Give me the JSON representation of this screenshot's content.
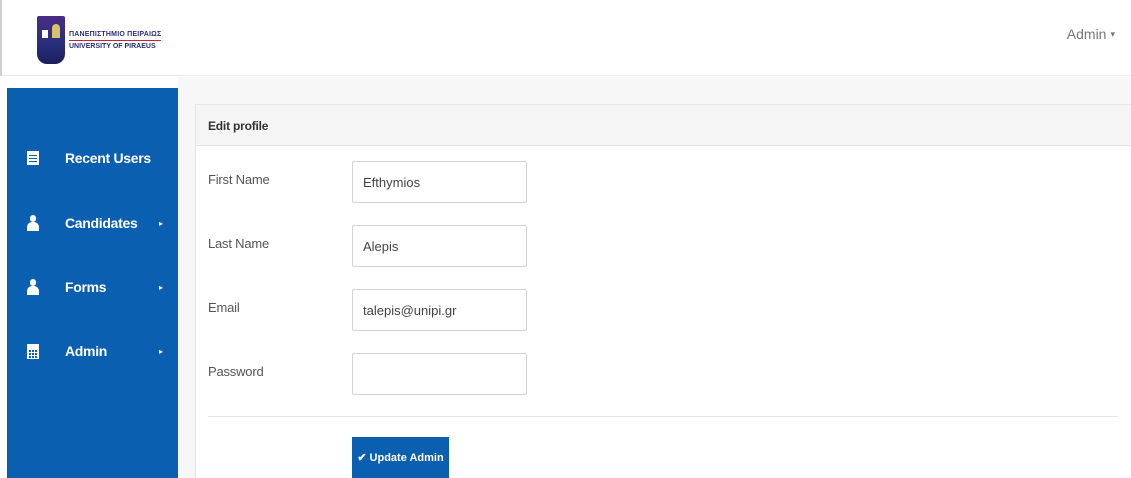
{
  "header": {
    "logo": {
      "greek": "ΠΑΝΕΠΙΣΤΗΜΙΟ ΠΕΙΡΑΙΩΣ",
      "english": "UNIVERSITY OF PIRAEUS"
    },
    "user_menu_label": "Admin",
    "user_menu_caret": "▾"
  },
  "sidebar": {
    "items": [
      {
        "label": "Recent Users",
        "icon": "list-icon",
        "has_submenu": false
      },
      {
        "label": "Candidates",
        "icon": "user-icon",
        "has_submenu": true
      },
      {
        "label": "Forms",
        "icon": "user-icon",
        "has_submenu": true
      },
      {
        "label": "Admin",
        "icon": "calendar-icon",
        "has_submenu": true
      }
    ],
    "submenu_arrow": "▸"
  },
  "panel": {
    "title": "Edit profile",
    "fields": [
      {
        "label": "First Name",
        "value": "Efthymios",
        "placeholder": ""
      },
      {
        "label": "Last Name",
        "value": "Alepis",
        "placeholder": ""
      },
      {
        "label": "Email",
        "value": "talepis@unipi.gr",
        "placeholder": ""
      },
      {
        "label": "Password",
        "value": "",
        "placeholder": ""
      }
    ],
    "submit": {
      "icon": "✔",
      "label": "Update Admin"
    }
  },
  "colors": {
    "sidebar": "#0b5fb0",
    "button": "#0b5fb0"
  }
}
